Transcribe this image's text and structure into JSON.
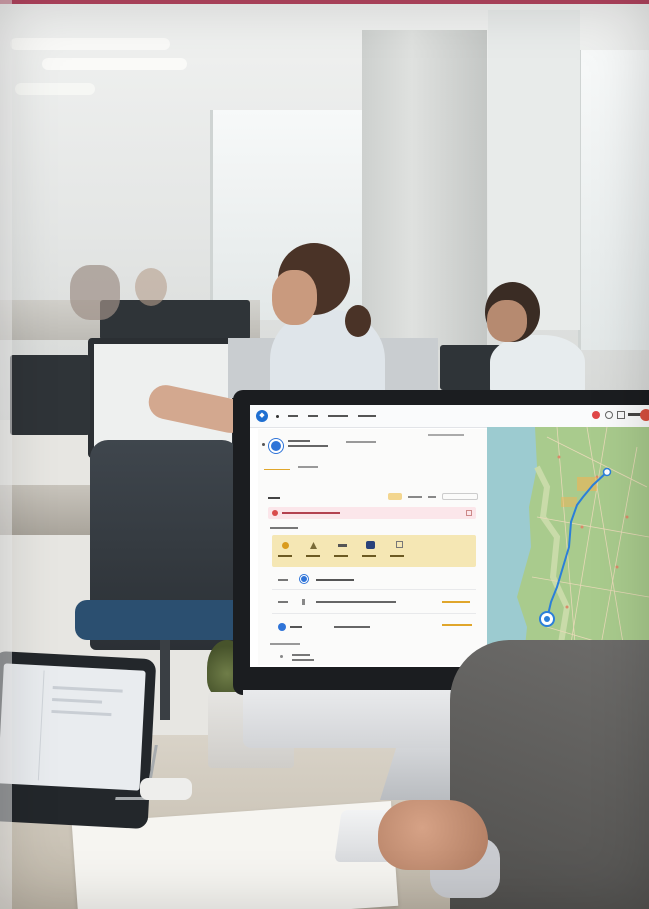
{
  "scene": {
    "description_tag": "office-with-routing-app"
  },
  "screen_app": {
    "nav_items": [
      "",
      "",
      "",
      "",
      ""
    ],
    "panel": {
      "title_line": "",
      "subtitle_line": "",
      "tabs": [
        "",
        ""
      ],
      "section_label": "",
      "alert_text": "",
      "chips": [
        "",
        "",
        "",
        "",
        ""
      ],
      "stops": [
        {
          "time": "",
          "label": ""
        },
        {
          "time": "",
          "label": ""
        },
        {
          "time": "",
          "label": ""
        }
      ]
    },
    "colors": {
      "accent": "#e0a62b",
      "brand": "#1f6fd1",
      "route": "#2b7fd9",
      "map_land": "#a7c98b",
      "map_water": "#9ccbd0"
    }
  }
}
